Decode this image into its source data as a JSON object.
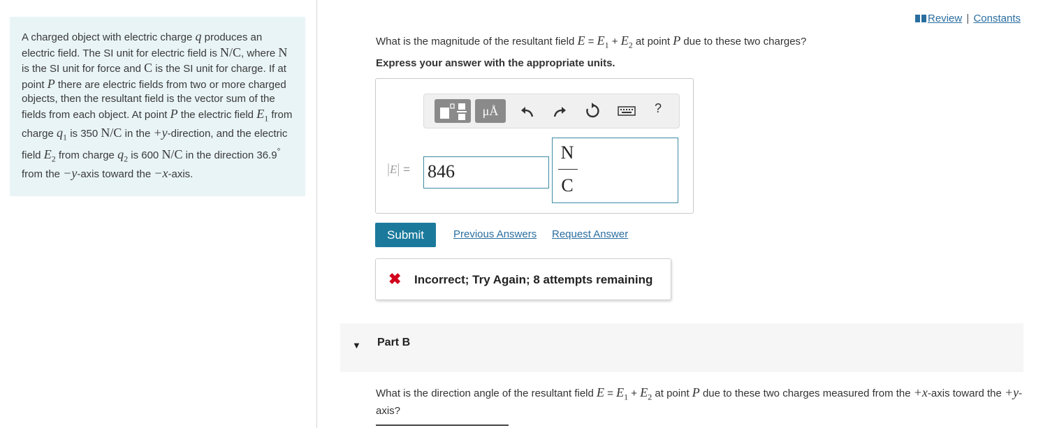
{
  "links": {
    "review": "Review",
    "separator": "|",
    "constants": "Constants"
  },
  "problem": {
    "t1": "A charged object with electric charge ",
    "q": "q",
    "t2": " produces an electric field. The SI unit for electric field is ",
    "NC": "N/C",
    "t3": ", where ",
    "N": "N",
    "t4": " is the SI unit for force and ",
    "C": "C",
    "t5": " is the SI unit for charge. If at point ",
    "P": "P",
    "t6": " there are electric fields from two or more charged objects, then the resultant field is the vector sum of the fields from each object. At point ",
    "t7": " the electric field ",
    "E1": "E",
    "sub1": "1",
    "t8": " from charge ",
    "q1": "q",
    "t9": " is ",
    "v350": "350 ",
    "t10": " in the ",
    "plusy": "+y",
    "t11": "-direction, and the electric field ",
    "t12": " from charge ",
    "sub2": "2",
    "t13": " is 600 ",
    "t14": " in the direction 36.9",
    "deg": "°",
    "t15": " from the ",
    "negy": "−y",
    "t16": "-axis toward the ",
    "negx": "−x",
    "t17": "-axis."
  },
  "partA": {
    "q_prefix": "What is the magnitude of the resultant field ",
    "eq": " = ",
    "plus": " + ",
    "q_mid": " at point ",
    "q_suffix": " due to these two charges?",
    "express": "Express your answer with the appropriate units.",
    "units_btn": "μÅ",
    "help": "?",
    "label_E": "E",
    "label_eq": "=",
    "value": "846",
    "unit_num": "N",
    "unit_den": "C",
    "submit": "Submit",
    "previous_answers": "Previous Answers",
    "request_answer": "Request Answer",
    "feedback_icon": "✖",
    "feedback": "Incorrect; Try Again; 8 attempts remaining"
  },
  "partB": {
    "caret": "▼",
    "title": "Part B",
    "q_prefix": "What is the direction angle of the resultant field ",
    "q_mid": " at point ",
    "q_suffix1": " due to these two charges measured from the ",
    "plusx": "+x",
    "q_suffix2": "-axis toward the ",
    "plusy": "+y",
    "q_suffix3": "-axis?"
  },
  "colors": {
    "panel_bg": "#e9f4f6",
    "accent": "#1b7a9c",
    "link": "#2a6ea0",
    "error": "#d0021b"
  }
}
